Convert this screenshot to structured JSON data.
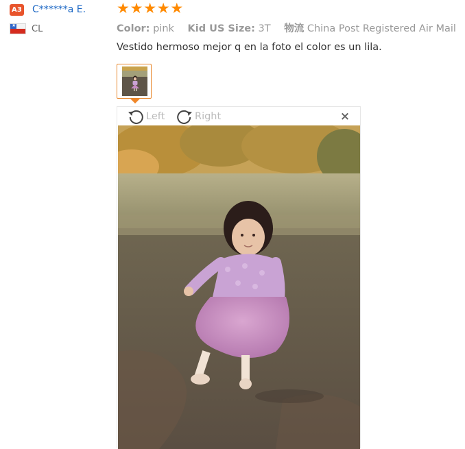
{
  "user": {
    "level_badge": "A3",
    "name": "C******a E.",
    "country_code": "CL",
    "flag_icon": "chile-flag-icon"
  },
  "review": {
    "rating": 5,
    "stars": [
      "★",
      "★",
      "★",
      "★",
      "★"
    ],
    "meta": {
      "color_label": "Color:",
      "color_value": "pink",
      "size_label": "Kid US Size:",
      "size_value": "3T",
      "shipping_label": "物流",
      "shipping_value": "China Post Registered Air Mail"
    },
    "text": "Vestido hermoso mejor q en la foto el color es un lila."
  },
  "viewer": {
    "rotate_left_label": "Left",
    "rotate_right_label": "Right",
    "close_symbol": "×"
  },
  "colors": {
    "badge": "#e8542c",
    "username": "#1a66c4",
    "star": "#ff8a00",
    "thumb_border": "#e8872c",
    "meta_text": "#999999"
  }
}
